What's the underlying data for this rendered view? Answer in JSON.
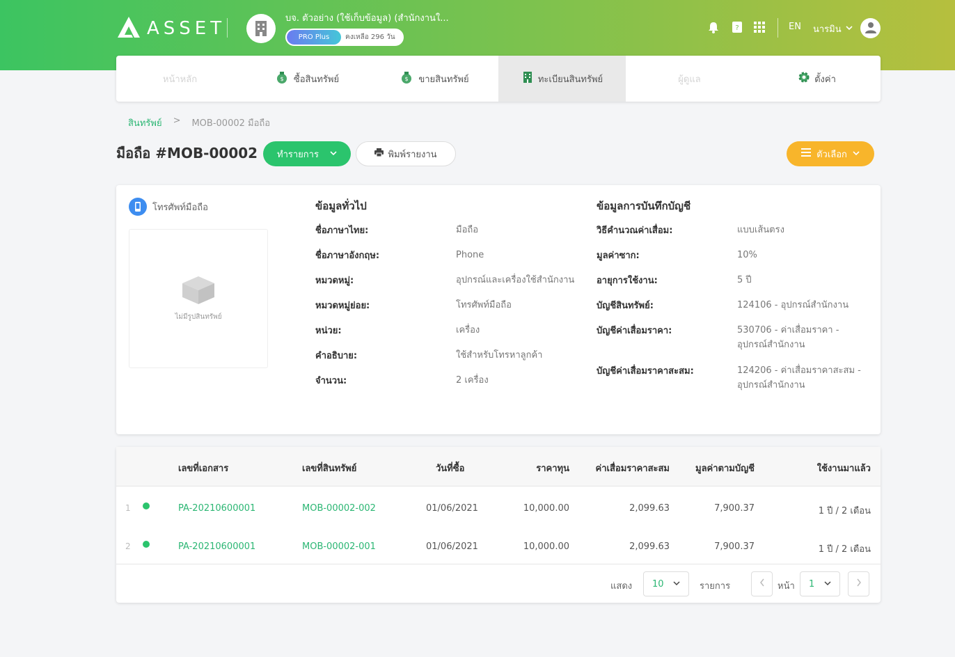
{
  "header": {
    "logo_text": "ASSET",
    "company_name": "บจ. ตัวอย่าง (ใช้เก็บข้อมูล) (สำนักงานใ...",
    "plan_badge": "PRO Plus",
    "plan_days": "คงเหลือ 296 วัน",
    "language": "EN",
    "user_name": "นารมิน"
  },
  "nav": {
    "home": "หน้าหลัก",
    "buy": "ซื้อสินทรัพย์",
    "sell": "ขายสินทรัพย์",
    "register": "ทะเบียนสินทรัพย์",
    "caretaker": "ผู้ดูแล",
    "settings": "ตั้งค่า"
  },
  "breadcrumb": {
    "root": "สินทรัพย์",
    "separator": ">",
    "current": "MOB-00002 มือถือ"
  },
  "page": {
    "title": "มือถือ #MOB-00002",
    "action_button": "ทำรายการ",
    "print_button": "พิมพ์รายงาน",
    "options_button": "ตัวเลือก"
  },
  "asset": {
    "type_label": "โทรศัพท์มือถือ",
    "no_image": "ไม่มีรูปสินทรัพย์"
  },
  "general": {
    "title": "ข้อมูลทั่วไป",
    "fields": [
      {
        "k": "ชื่อภาษาไทย:",
        "v": "มือถือ"
      },
      {
        "k": "ชื่อภาษาอังกฤษ:",
        "v": "Phone"
      },
      {
        "k": "หมวดหมู่:",
        "v": "อุปกรณ์และเครื่องใช้สำนักงาน"
      },
      {
        "k": "หมวดหมู่ย่อย:",
        "v": "โทรศัพท์มือถือ"
      },
      {
        "k": "หน่วย:",
        "v": "เครื่อง"
      },
      {
        "k": "คำอธิบาย:",
        "v": "ใช้สำหรับโทรหาลูกค้า"
      },
      {
        "k": "จำนวน:",
        "v": "2 เครื่อง"
      }
    ]
  },
  "accounting": {
    "title": "ข้อมูลการบันทึกบัญชี",
    "fields": [
      {
        "k": "วิธีคำนวณค่าเสื่อม:",
        "v": "แบบเส้นตรง"
      },
      {
        "k": "มูลค่าซาก:",
        "v": "10%"
      },
      {
        "k": "อายุการใช้งาน:",
        "v": "5 ปี"
      },
      {
        "k": "บัญชีสินทรัพย์:",
        "v": "124106 - อุปกรณ์สำนักงาน"
      },
      {
        "k": "บัญชีค่าเสื่อมราคา:",
        "v": "530706 - ค่าเสื่อมราคา -",
        "v2": "อุปกรณ์สำนักงาน"
      },
      {
        "k": "บัญชีค่าเสื่อมราคาสะสม:",
        "v": "124206 - ค่าเสื่อมราคาสะสม -",
        "v2": "อุปกรณ์สำนักงาน"
      }
    ]
  },
  "table": {
    "headers": [
      "เลขที่เอกสาร",
      "เลขที่สินทรัพย์",
      "วันที่ซื้อ",
      "ราคาทุน",
      "ค่าเสื่อมราคาสะสม",
      "มูลค่าตามบัญชี",
      "ใช้งานมาแล้ว"
    ],
    "rows": [
      {
        "no": "1",
        "doc": "PA-20210600001",
        "asset": "MOB-00002-002",
        "date": "01/06/2021",
        "cost": "10,000.00",
        "dep": "2,099.63",
        "book": "7,900.37",
        "used": "1 ปี / 2 เดือน"
      },
      {
        "no": "2",
        "doc": "PA-20210600001",
        "asset": "MOB-00002-001",
        "date": "01/06/2021",
        "cost": "10,000.00",
        "dep": "2,099.63",
        "book": "7,900.37",
        "used": "1 ปี / 2 เดือน"
      }
    ]
  },
  "pagination": {
    "show_label": "แสดง",
    "page_size": "10",
    "items_label": "รายการ",
    "page_label": "หน้า",
    "current_page": "1"
  },
  "colors": {
    "brand_green": "#2bc46d",
    "link_green": "#2bb673",
    "options_orange": "#f8b52b"
  }
}
